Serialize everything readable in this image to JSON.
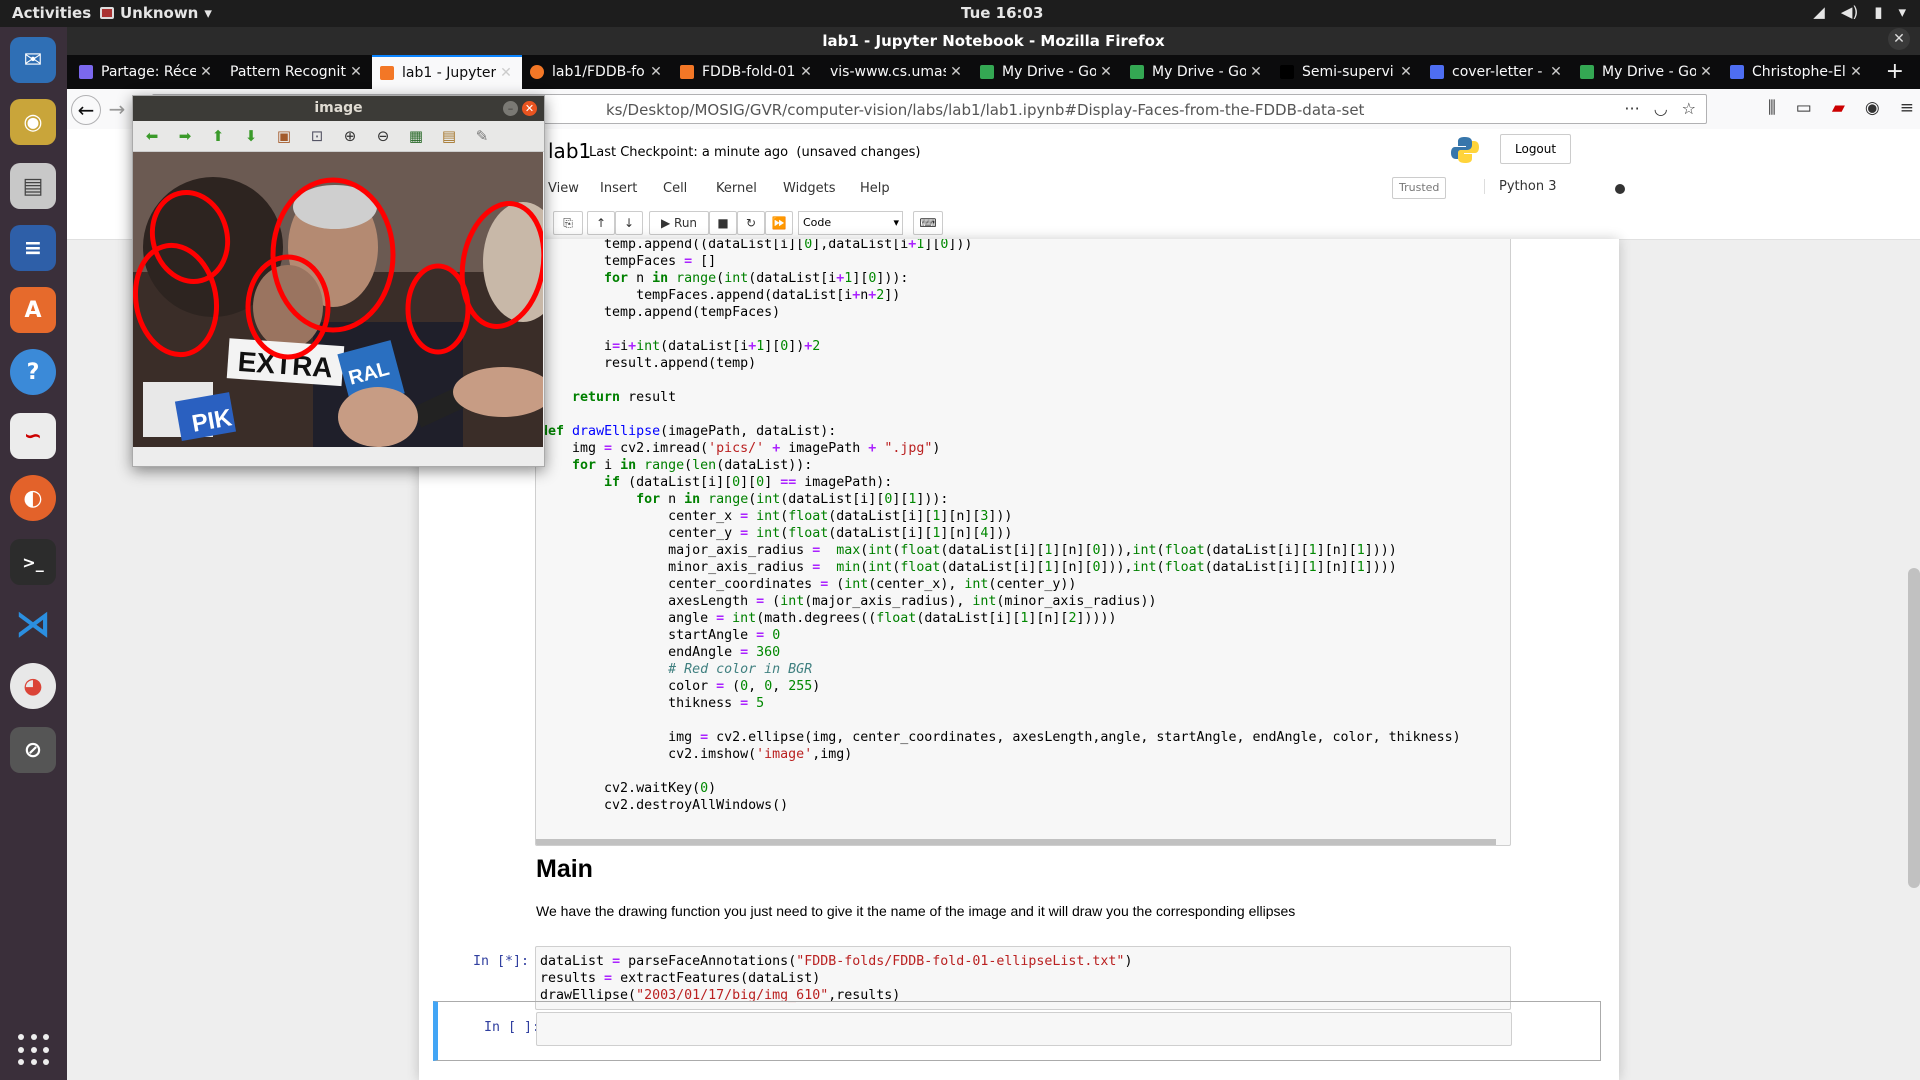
{
  "topbar": {
    "activities": "Activities",
    "app": "Unknown",
    "clock": "Tue 16:03"
  },
  "window": {
    "title": "lab1 - Jupyter Notebook - Mozilla Firefox"
  },
  "tabs": [
    {
      "label": "Partage: Réce",
      "color": "#7b68ee"
    },
    {
      "label": "Pattern Recognit",
      "color": ""
    },
    {
      "label": "lab1 - Jupyter",
      "color": "#f37726",
      "active": true
    },
    {
      "label": "lab1/FDDB-fo",
      "color": "#f37726"
    },
    {
      "label": "FDDB-fold-01",
      "color": "#f37726"
    },
    {
      "label": "vis-www.cs.umas",
      "color": ""
    },
    {
      "label": "My Drive - Go",
      "color": "#34a853"
    },
    {
      "label": "My Drive - Go",
      "color": "#34a853"
    },
    {
      "label": "Semi-supervi",
      "color": "#000000"
    },
    {
      "label": "cover-letter -",
      "color": "#4e6ef2"
    },
    {
      "label": "My Drive - Go",
      "color": "#34a853"
    },
    {
      "label": "Christophe-El",
      "color": "#4e6ef2"
    }
  ],
  "url": "ks/Desktop/MOSIG/GVR/computer-vision/labs/lab1/lab1.ipynb#Display-Faces-from-the-FDDB-data-set",
  "jupyter": {
    "name": "lab1",
    "checkpoint": "Last Checkpoint: a minute ago",
    "unsaved": "(unsaved changes)",
    "logout": "Logout",
    "menu": [
      "View",
      "Insert",
      "Cell",
      "Kernel",
      "Widgets",
      "Help"
    ],
    "trusted": "Trusted",
    "kernel": "Python 3",
    "run": "Run",
    "cell_type": "Code"
  },
  "cell1_lines": [
    "        temp.append((dataList[i][0],dataList[i+1][0]))",
    "        tempFaces = []",
    "        for n in range(int(dataList[i+1][0])):",
    "            tempFaces.append(dataList[i+n+2])",
    "        temp.append(tempFaces)",
    "",
    "        i=i+int(dataList[i+1][0])+2",
    "        result.append(temp)",
    "",
    "    return result",
    "",
    "def drawEllipse(imagePath, dataList):",
    "    img = cv2.imread('pics/' + imagePath + \".jpg\")",
    "    for i in range(len(dataList)):",
    "        if (dataList[i][0][0] == imagePath):",
    "            for n in range(int(dataList[i][0][1])):",
    "                center_x = int(float(dataList[i][1][n][3]))",
    "                center_y = int(float(dataList[i][1][n][4]))",
    "                major_axis_radius =  max(int(float(dataList[i][1][n][0])),int(float(dataList[i][1][n][1])))",
    "                minor_axis_radius =  min(int(float(dataList[i][1][n][0])),int(float(dataList[i][1][n][1])))",
    "                center_coordinates = (int(center_x), int(center_y))",
    "                axesLength = (int(major_axis_radius), int(minor_axis_radius))",
    "                angle = int(math.degrees((float(dataList[i][1][n][2]))))",
    "                startAngle = 0",
    "                endAngle = 360",
    "                # Red color in BGR",
    "                color = (0, 0, 255)",
    "                thikness = 5",
    "",
    "                img = cv2.ellipse(img, center_coordinates, axesLength,angle, startAngle, endAngle, color, thikness)",
    "                cv2.imshow('image',img)",
    "",
    "        cv2.waitKey(0)",
    "        cv2.destroyAllWindows()"
  ],
  "markdown": {
    "heading": "Main",
    "text": "We have the drawing function you just need to give it the name of the image and it will draw you the corresponding ellipses"
  },
  "cell2": {
    "prompt": "In [*]:",
    "lines": [
      "dataList = parseFaceAnnotations(\"FDDB-folds/FDDB-fold-01-ellipseList.txt\")",
      "results = extractFeatures(dataList)",
      "drawEllipse(\"2003/01/17/big/img_610\",results)"
    ]
  },
  "cell3": {
    "prompt": "In [ ]:"
  },
  "cvwindow": {
    "title": "image",
    "sign_text_1": "EXTRA",
    "sign_text_2": "PIK",
    "sign_text_3": "RAL"
  }
}
